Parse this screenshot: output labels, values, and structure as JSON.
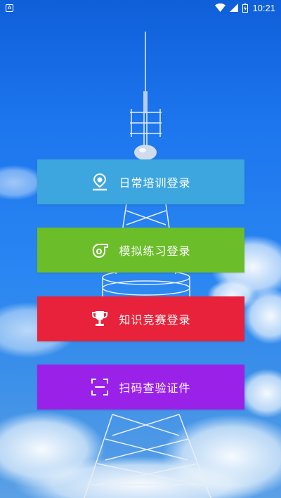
{
  "status_bar": {
    "notification_glyph": "A",
    "time": "10:21"
  },
  "menu": [
    {
      "label": "日常培训登录",
      "icon": "pen-tip-icon",
      "color": "#3ea6de"
    },
    {
      "label": "模拟练习登录",
      "icon": "whistle-icon",
      "color": "#6bbd2a"
    },
    {
      "label": "知识竞赛登录",
      "icon": "trophy-icon",
      "color": "#e8223a"
    },
    {
      "label": "扫码查验证件",
      "icon": "scan-icon",
      "color": "#9a22e8"
    }
  ]
}
